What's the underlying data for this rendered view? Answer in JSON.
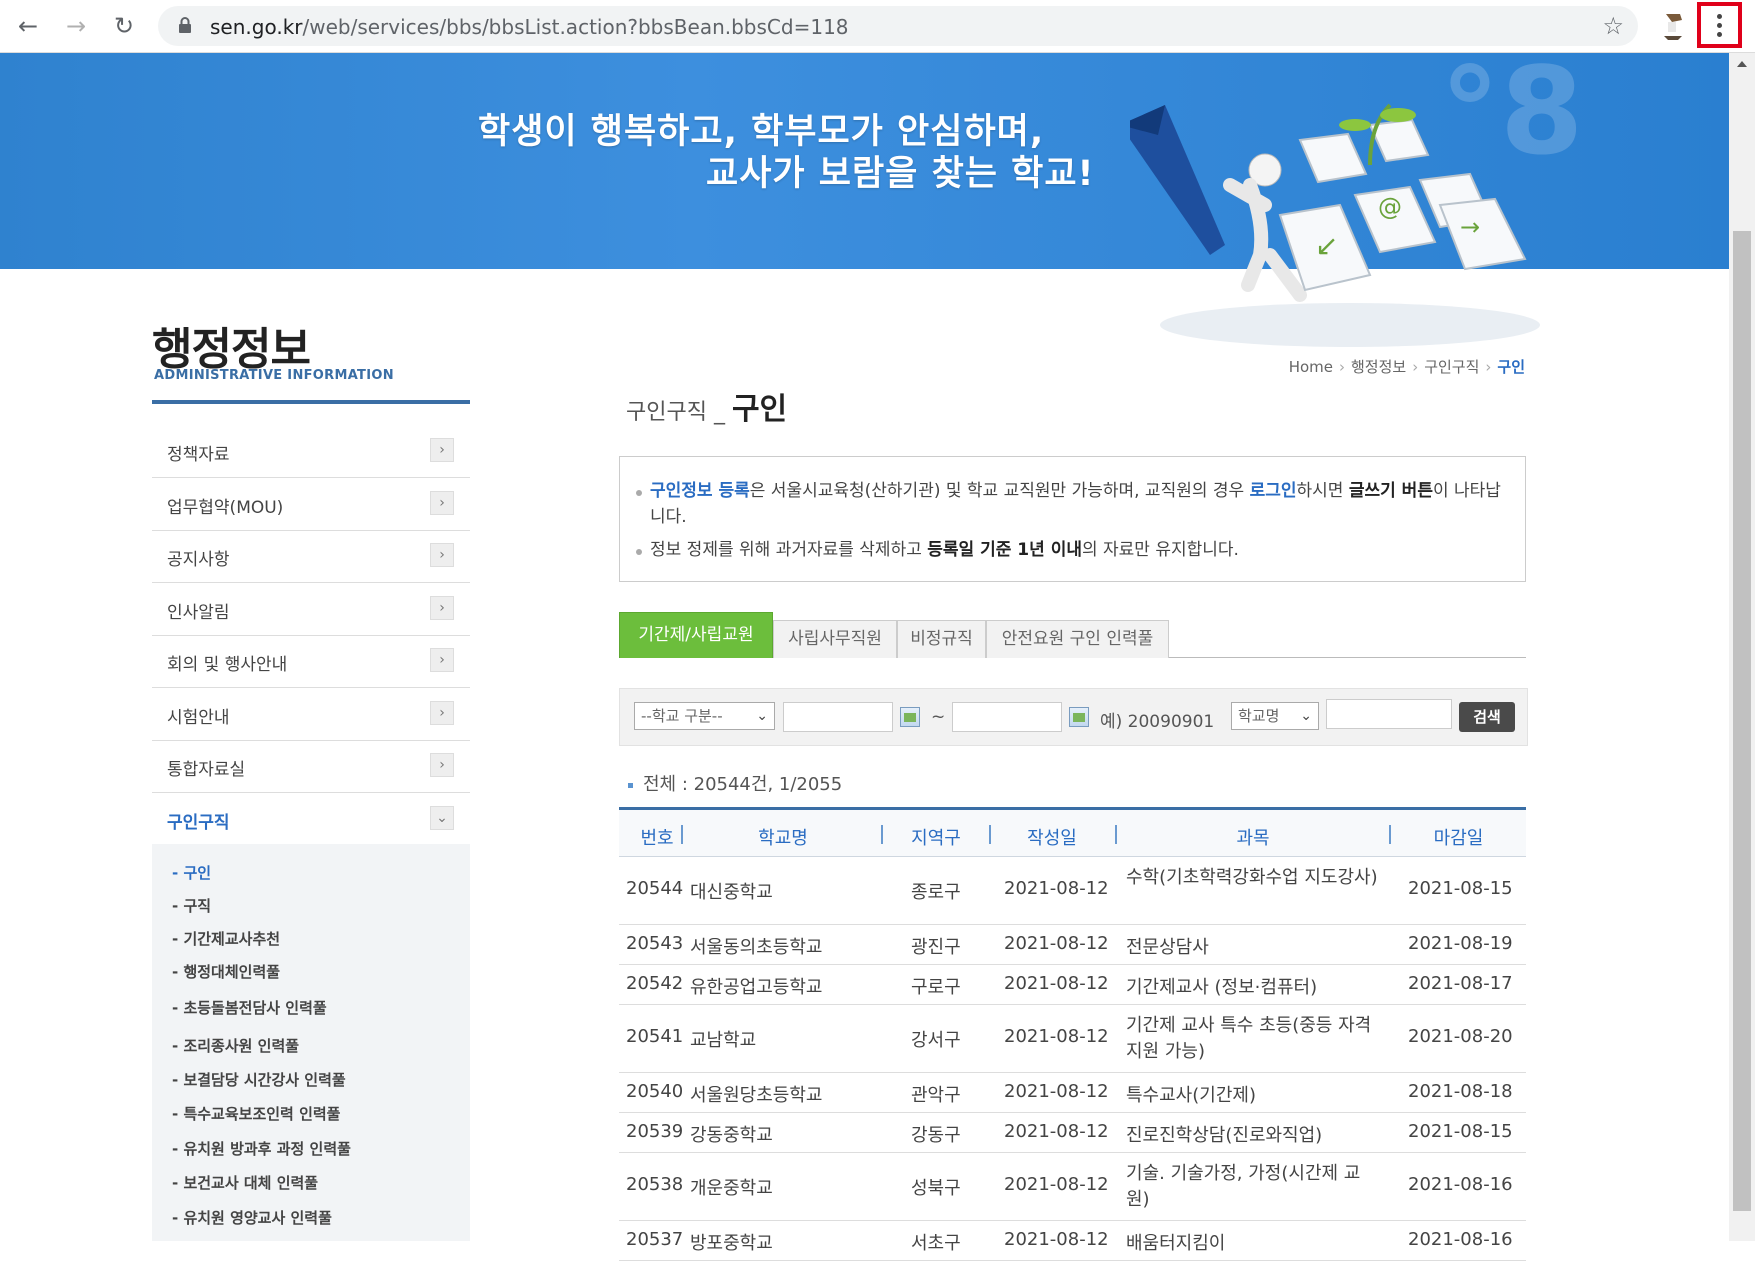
{
  "browser": {
    "url_domain": "sen.go.kr",
    "url_path": "/web/services/bbs/bbsList.action?bbsBean.bbsCd=118",
    "icons": [
      "back-icon",
      "forward-icon",
      "reload-icon",
      "lock-icon",
      "star-icon",
      "kebab-menu-icon"
    ]
  },
  "banner": {
    "line1": "학생이 행복하고, 학부모가 안심하며,",
    "line2": "교사가 보람을 찾는 학교!"
  },
  "sidebar": {
    "title": "행정정보",
    "subtitle": "ADMINISTRATIVE INFORMATION",
    "items": [
      {
        "label": "정책자료"
      },
      {
        "label": "업무협약(MOU)"
      },
      {
        "label": "공지사항"
      },
      {
        "label": "인사알림"
      },
      {
        "label": "회의 및 행사안내"
      },
      {
        "label": "시험안내"
      },
      {
        "label": "통합자료실"
      },
      {
        "label": "구인구직"
      }
    ],
    "subitems": [
      "- 구인",
      "- 구직",
      "- 기간제교사추천",
      "- 행정대체인력풀",
      "- 초등돌봄전담사 인력풀",
      "- 조리종사원 인력풀",
      "- 보결담당 시간강사 인력풀",
      "- 특수교육보조인력 인력풀",
      "- 유치원 방과후 과정 인력풀",
      "- 보건교사 대체 인력풀",
      "- 유치원 영양교사 인력풀"
    ]
  },
  "breadcrumb": {
    "home": "Home",
    "level1": "행정정보",
    "level2": "구인구직",
    "current": "구인"
  },
  "page": {
    "title_prefix": "구인구직 _ ",
    "title_main": "구인"
  },
  "notice": {
    "l1_hl": "구인정보 등록",
    "l1_a": "은 서울시교육청(산하기관) 및 학교 교직원만 가능하며, 교직원의 경우 ",
    "l1_login": "로그인",
    "l1_b": "하시면 ",
    "l1_bold": "글쓰기 버튼",
    "l1_c": "이 나타납니다.",
    "l2_a": "정보 정제를 위해 과거자료를 삭제하고 ",
    "l2_bold": "등록일 기준 1년 이내",
    "l2_b": "의 자료만 유지합니다."
  },
  "tabs": [
    "기간제/사립교원",
    "사립사무직원",
    "비정규직",
    "안전요원 구인 인력풀"
  ],
  "search": {
    "school_type": "--학교 구분--",
    "tilde": "~",
    "date_example": "예) 20090901",
    "field": "학교명",
    "button": "검색"
  },
  "summary": "전체 : 20544건, 1/2055",
  "table": {
    "headers": [
      "번호",
      "학교명",
      "지역구",
      "작성일",
      "과목",
      "마감일"
    ],
    "rows": [
      {
        "no": "20544",
        "school": "대신중학교",
        "district": "종로구",
        "date": "2021-08-12",
        "subject": "수학(기초학력강화수업 지도강사)",
        "deadline": "2021-08-15"
      },
      {
        "no": "20543",
        "school": "서울동의초등학교",
        "district": "광진구",
        "date": "2021-08-12",
        "subject": "전문상담사",
        "deadline": "2021-08-19"
      },
      {
        "no": "20542",
        "school": "유한공업고등학교",
        "district": "구로구",
        "date": "2021-08-12",
        "subject": "기간제교사 (정보·컴퓨터)",
        "deadline": "2021-08-17"
      },
      {
        "no": "20541",
        "school": "교남학교",
        "district": "강서구",
        "date": "2021-08-12",
        "subject": "기간제 교사 특수 초등(중등 자격 지원 가능)",
        "deadline": "2021-08-20"
      },
      {
        "no": "20540",
        "school": "서울원당초등학교",
        "district": "관악구",
        "date": "2021-08-12",
        "subject": "특수교사(기간제)",
        "deadline": "2021-08-18"
      },
      {
        "no": "20539",
        "school": "강동중학교",
        "district": "강동구",
        "date": "2021-08-12",
        "subject": "진로진학상담(진로와직업)",
        "deadline": "2021-08-15"
      },
      {
        "no": "20538",
        "school": "개운중학교",
        "district": "성북구",
        "date": "2021-08-12",
        "subject": "기술. 기술가정, 가정(시간제 교원)",
        "deadline": "2021-08-16"
      },
      {
        "no": "20537",
        "school": "방포중학교",
        "district": "서초구",
        "date": "2021-08-12",
        "subject": "배움터지킴이",
        "deadline": "2021-08-16"
      }
    ]
  }
}
